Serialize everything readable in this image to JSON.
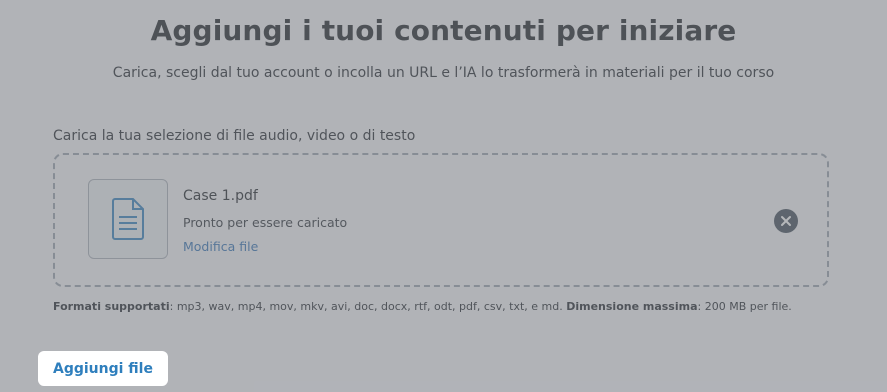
{
  "header": {
    "title": "Aggiungi i tuoi contenuti per iniziare",
    "subtitle": "Carica, scegli dal tuo account o incolla un URL e l’IA lo trasformerà in materiali per il tuo corso"
  },
  "upload": {
    "label": "Carica la tua selezione di file audio, video o di testo",
    "file": {
      "icon": "document-icon",
      "name": "Case 1.pdf",
      "status": "Pronto per essere caricato",
      "edit_label": "Modifica file",
      "remove_icon": "close-circle-icon"
    },
    "formats_label": "Formati supportati",
    "formats_list": ": mp3, wav, mp4, mov, mkv, avi, doc, docx, rtf, odt, pdf, csv, txt, e md. ",
    "max_size_label": "Dimensione massima",
    "max_size_value": ": 200 MB per file."
  },
  "actions": {
    "add_file_label": "Aggiungi file"
  },
  "colors": {
    "link": "#2f6fb3",
    "button_text": "#2f7fbd",
    "remove_button": "#3f4b57",
    "overlay": "rgba(120,124,130,0.55)"
  }
}
